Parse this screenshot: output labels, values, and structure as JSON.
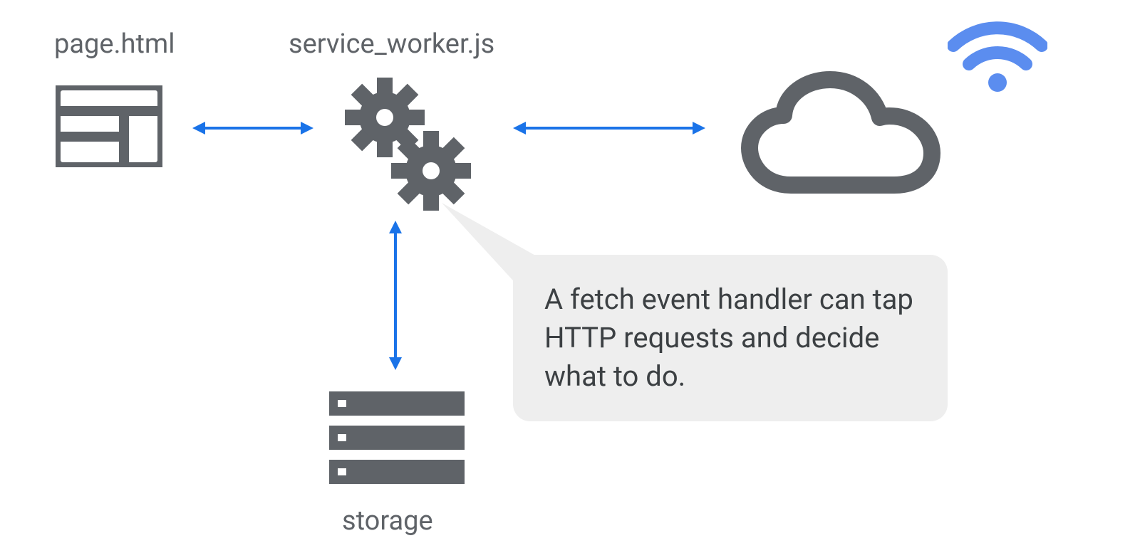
{
  "labels": {
    "page": "page.html",
    "service_worker": "service_worker.js",
    "storage": "storage"
  },
  "callout_text": "A fetch event handler can tap HTTP requests and decide what to do.",
  "colors": {
    "icon_gray": "#5f6368",
    "arrow_blue": "#1a73e8",
    "wifi_blue": "#5b8def",
    "callout_bg": "#eeeeee"
  }
}
